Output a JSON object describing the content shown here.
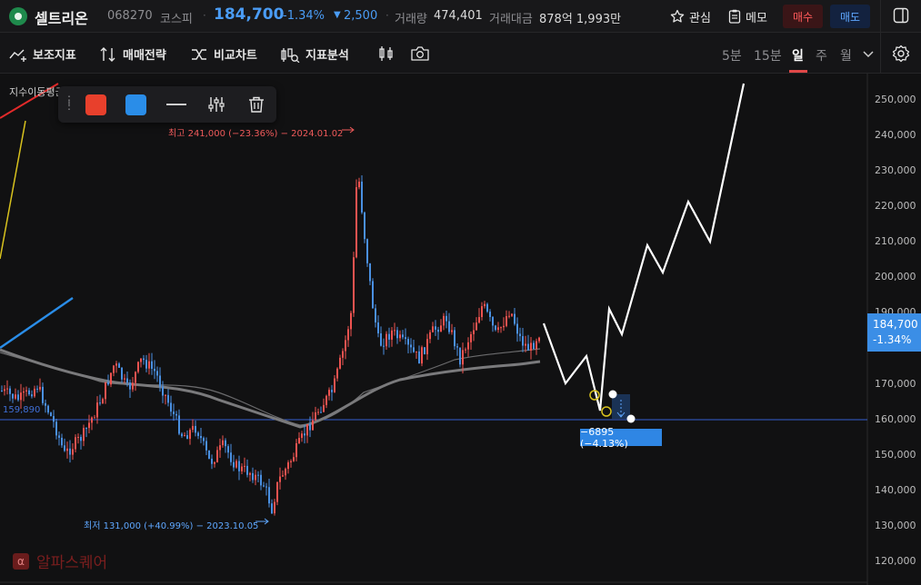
{
  "header": {
    "stock_name": "셀트리온",
    "stock_code": "068270",
    "market": "코스피",
    "price": "184,700",
    "change_pct": "-1.34%",
    "change_arrow": "▼",
    "change": "2,500",
    "volume_label": "거래량",
    "volume": "474,401",
    "amount_label": "거래대금",
    "amount": "878억 1,993만",
    "watch_label": "관심",
    "memo_label": "메모",
    "buy_label": "매수",
    "sell_label": "매도"
  },
  "toolbar": {
    "indicator_label": "보조지표",
    "strategy_label": "매매전략",
    "compare_label": "비교차트",
    "analysis_label": "지표분석",
    "periods": [
      "5분",
      "15분",
      "일",
      "주",
      "월"
    ],
    "active_period": "일"
  },
  "draw_toolbar": {
    "colors": [
      "#e8402c",
      "#2a8de8"
    ]
  },
  "chart": {
    "ma_legend": "지수이동평균",
    "y_axis": [
      "250,000",
      "240,000",
      "230,000",
      "220,000",
      "210,000",
      "200,000",
      "190,000",
      "180,000",
      "170,000",
      "160,000",
      "150,000",
      "140,000",
      "130,000",
      "120,000"
    ],
    "current_price": "184,700",
    "current_pct": "-1.34%",
    "high_annotation": "최고 241,000 (−23.36%) − 2024.01.02",
    "low_annotation": "최저 131,000 (+40.99%) − 2023.10.05",
    "hline_label": "159,890",
    "measure_label": "−6895 (−4.13%)",
    "colors": {
      "up": "#ef5350",
      "down": "#4a90e2",
      "accent": "#3b8ee6"
    }
  },
  "watermark": {
    "icon": "α",
    "text": "알파스퀘어"
  }
}
